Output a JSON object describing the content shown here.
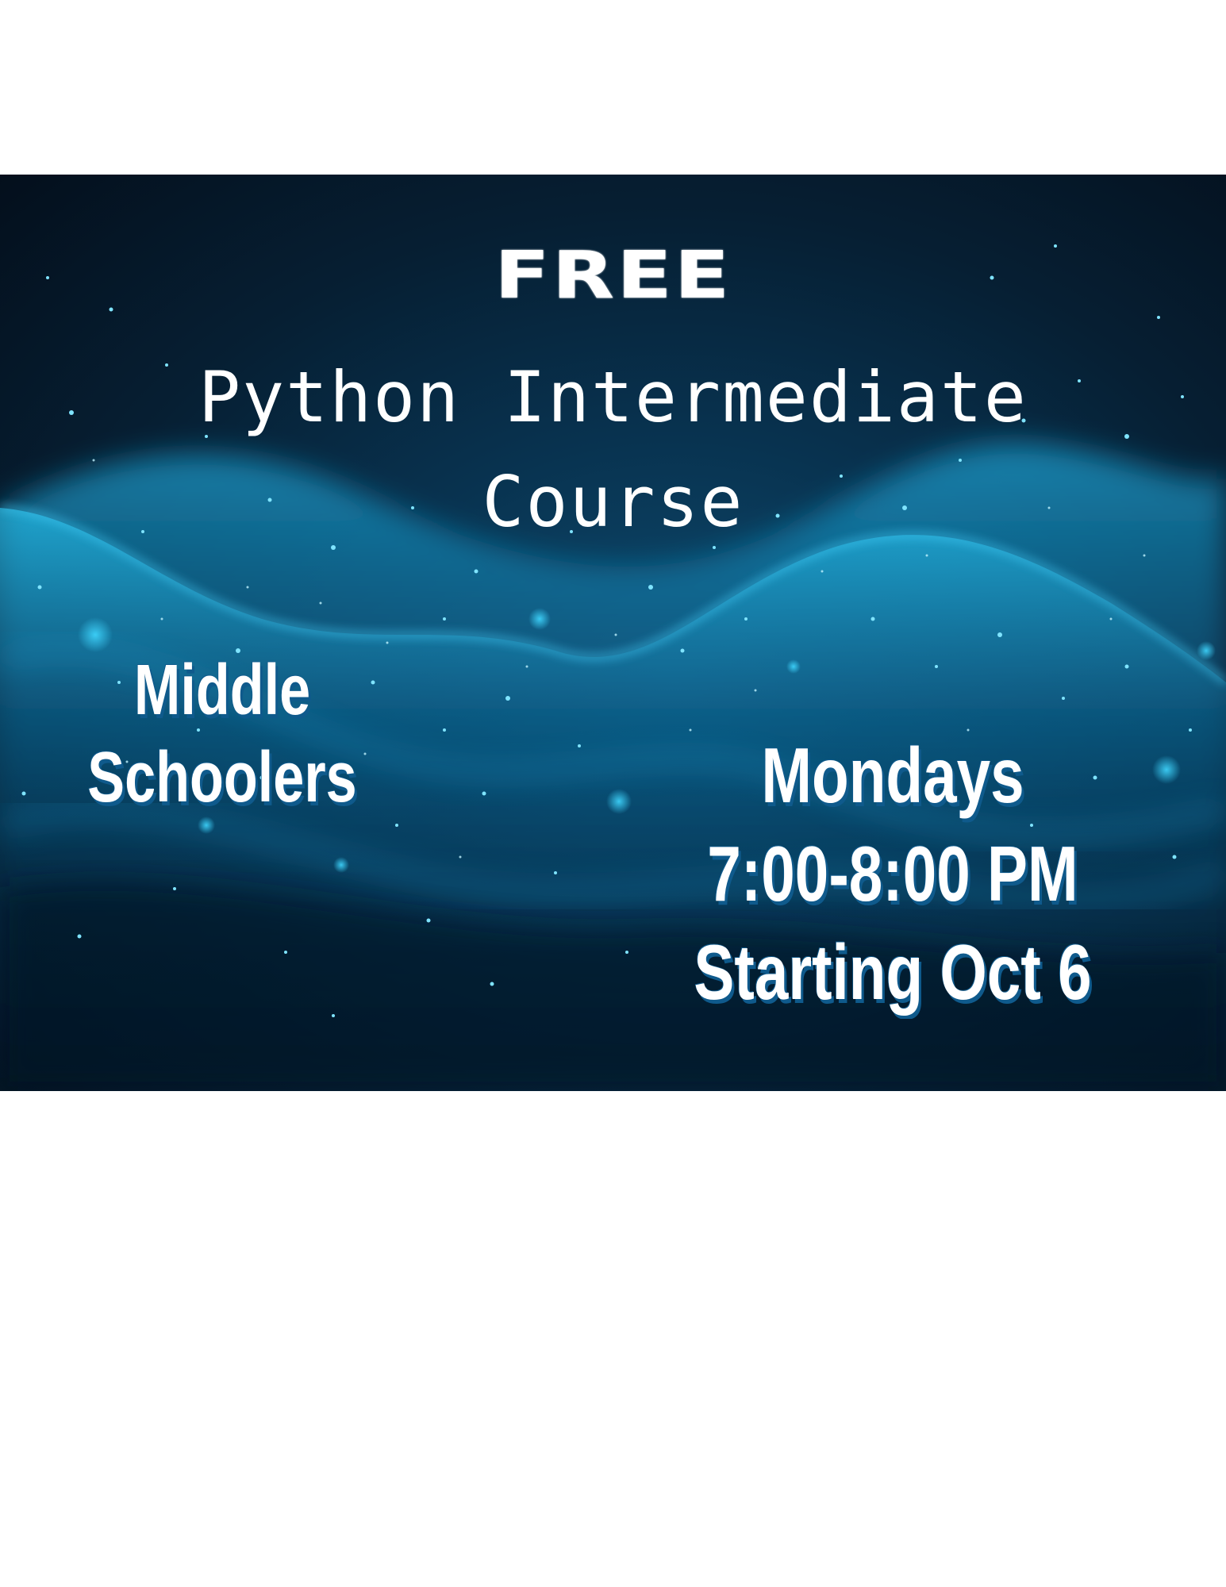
{
  "flyer": {
    "headline": "FREE",
    "title_line1": "Python Intermediate",
    "title_line2": "Course",
    "audience_line1": "Middle",
    "audience_line2": "Schoolers",
    "day": "Mondays",
    "time": "7:00-8:00 PM",
    "start": "Starting Oct 6"
  },
  "colors": {
    "background_dark": "#040f1c",
    "background_mid": "#08324f",
    "wave_glow": "#1fb6e6",
    "text": "#ffffff",
    "text_shadow": "#0f5a8c"
  },
  "background_image": "glowing-particle-wave"
}
